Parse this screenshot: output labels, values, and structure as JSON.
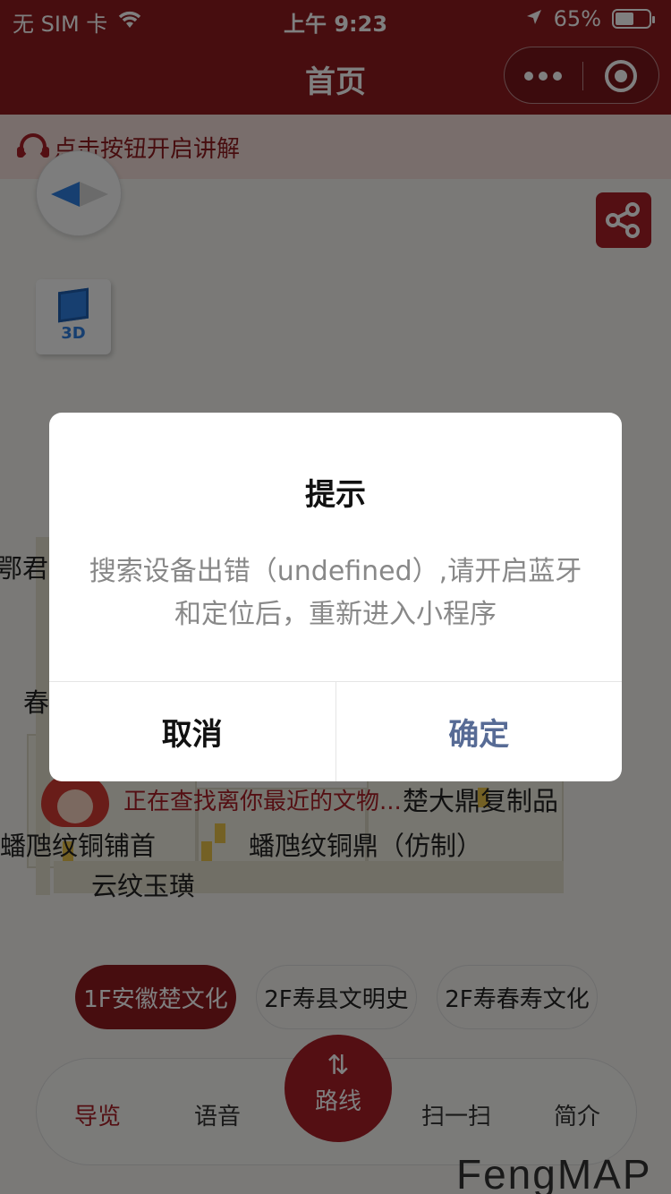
{
  "status_bar": {
    "carrier": "无 SIM 卡",
    "time": "上午 9:23",
    "battery_percent": "65%",
    "battery_level": 0.65
  },
  "nav": {
    "title": "首页",
    "more_icon": "more-dots-icon",
    "close_icon": "target-icon"
  },
  "banner": {
    "text": "点击按钮开启讲解",
    "icon": "headset-icon"
  },
  "map": {
    "controls": {
      "compass_icon": "compass-icon",
      "view3d_label": "3D",
      "share_icon": "share-icon"
    },
    "labels": {
      "e_jun": "鄂君",
      "chun": "春",
      "chu_dading": "楚大鼎复制品",
      "panhui_tongpushou": "蟠虺纹铜铺首",
      "panhui_tongding": "蟠虺纹铜鼎（仿制）",
      "yunwen_yuhuang": "云纹玉璜"
    },
    "searching_text": "正在查找离你最近的文物..."
  },
  "floor_tabs": [
    {
      "label": "1F安徽楚文化",
      "active": true
    },
    {
      "label": "2F寿县文明史",
      "active": false
    },
    {
      "label": "2F寿春寿文化",
      "active": false
    }
  ],
  "bottom_nav": {
    "guide": "导览",
    "voice": "语音",
    "route": "路线",
    "scan": "扫一扫",
    "intro": "简介"
  },
  "brand": {
    "part1": "FengMAP"
  },
  "dialog": {
    "title": "提示",
    "message": "搜索设备出错（undefined）,请开启蓝牙和定位后，重新进入小程序",
    "cancel": "取消",
    "confirm": "确定"
  },
  "colors": {
    "primary": "#8f1a1f",
    "accent": "#a81e26",
    "confirm_blue": "#576b95"
  }
}
